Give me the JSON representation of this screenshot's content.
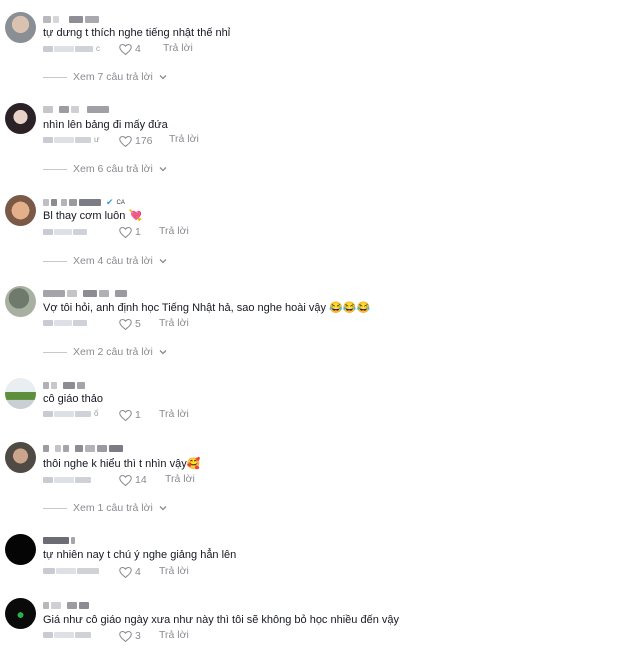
{
  "comments": [
    {
      "text": "tự dưng t thích nghe tiếng nhật thế nhỉ",
      "date_suffix": "c",
      "likes": "4",
      "reply_label": "Trả lời",
      "view_replies": "Xem 7 câu trả lời"
    },
    {
      "text": "nhìn lên bảng đi mấy đứa",
      "date_suffix": "ư",
      "likes": "176",
      "reply_label": "Trả lời",
      "view_replies": "Xem 6 câu trả lời"
    },
    {
      "text": "Bl thay cơm luôn 💘",
      "username_badge": "CA",
      "date_suffix": "",
      "likes": "1",
      "reply_label": "Trả lời",
      "view_replies": "Xem 4 câu trả lời"
    },
    {
      "text": "Vợ tôi hỏi, anh định học Tiếng Nhật hả, sao nghe hoài vậy 😂😂😂",
      "date_suffix": "",
      "likes": "5",
      "reply_label": "Trả lời",
      "view_replies": "Xem 2 câu trả lời"
    },
    {
      "text": "cô giáo thảo",
      "date_suffix": "ố",
      "likes": "1",
      "reply_label": "Trả lời",
      "view_replies": ""
    },
    {
      "text": "thôi nghe k hiểu thì t nhìn vậy🥰",
      "date_suffix": "",
      "likes": "14",
      "reply_label": "Trả lời",
      "view_replies": "Xem 1 câu trả lời"
    },
    {
      "text": "tự nhiên nay t chú ý nghe giảng hẳn lên",
      "date_suffix": "",
      "likes": "4",
      "reply_label": "Trả lời",
      "view_replies": ""
    },
    {
      "text": "Giá như cô giáo ngày xưa như này thì tôi sẽ không bỏ học nhiều đến vậy",
      "date_suffix": "",
      "likes": "3",
      "reply_label": "Trả lời",
      "view_replies": ""
    }
  ],
  "icons": {
    "like": "heart-outline-icon",
    "expand": "chevron-down-icon",
    "verified": "check-badge-icon"
  },
  "colors": {
    "text": "#161823",
    "muted": "#8a8b91",
    "divider": "#c8c8cc"
  }
}
